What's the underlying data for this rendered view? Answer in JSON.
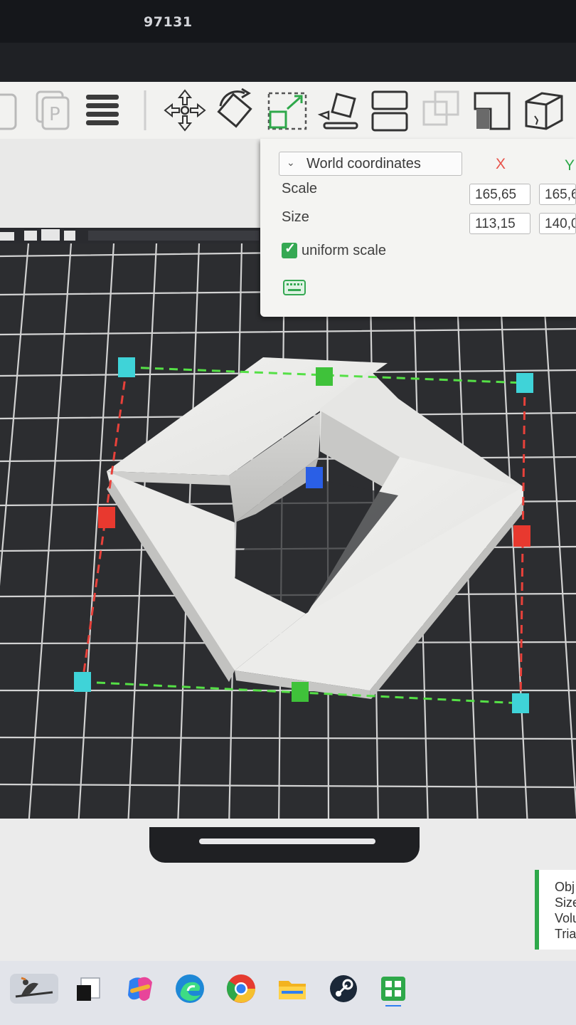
{
  "window": {
    "title": "97131"
  },
  "toolbar": {
    "icons": [
      "open-icon",
      "parts-icon",
      "layers-menu-icon",
      "move-icon",
      "rotate-icon",
      "scale-icon",
      "place-on-face-icon",
      "split-icon",
      "merge-icon",
      "cut-icon",
      "body-icon"
    ]
  },
  "panel": {
    "coordinate_system": "World coordinates",
    "axes": {
      "x": "X",
      "y": "Y"
    },
    "scale": {
      "label": "Scale",
      "x": "165,65",
      "y": "165,6"
    },
    "size": {
      "label": "Size",
      "x": "113,15",
      "y": "140,0"
    },
    "uniform_scale": {
      "label": "uniform scale",
      "checked": true
    }
  },
  "object_info": {
    "lines": [
      "Obj",
      "Size",
      "Volu",
      "Tria"
    ]
  },
  "colors": {
    "accent": "#35a853",
    "axis_x": "#e8524a",
    "axis_y": "#2ea84a",
    "gizmo_corner": "#3fd3d8",
    "gizmo_center": "#2a5fe6"
  },
  "taskbar": {
    "icons": [
      "bird-wallpaper-icon",
      "taskview-icon",
      "copilot-icon",
      "edge-icon",
      "chrome-icon",
      "file-explorer-icon",
      "steam-icon",
      "slicer-app-icon"
    ]
  }
}
